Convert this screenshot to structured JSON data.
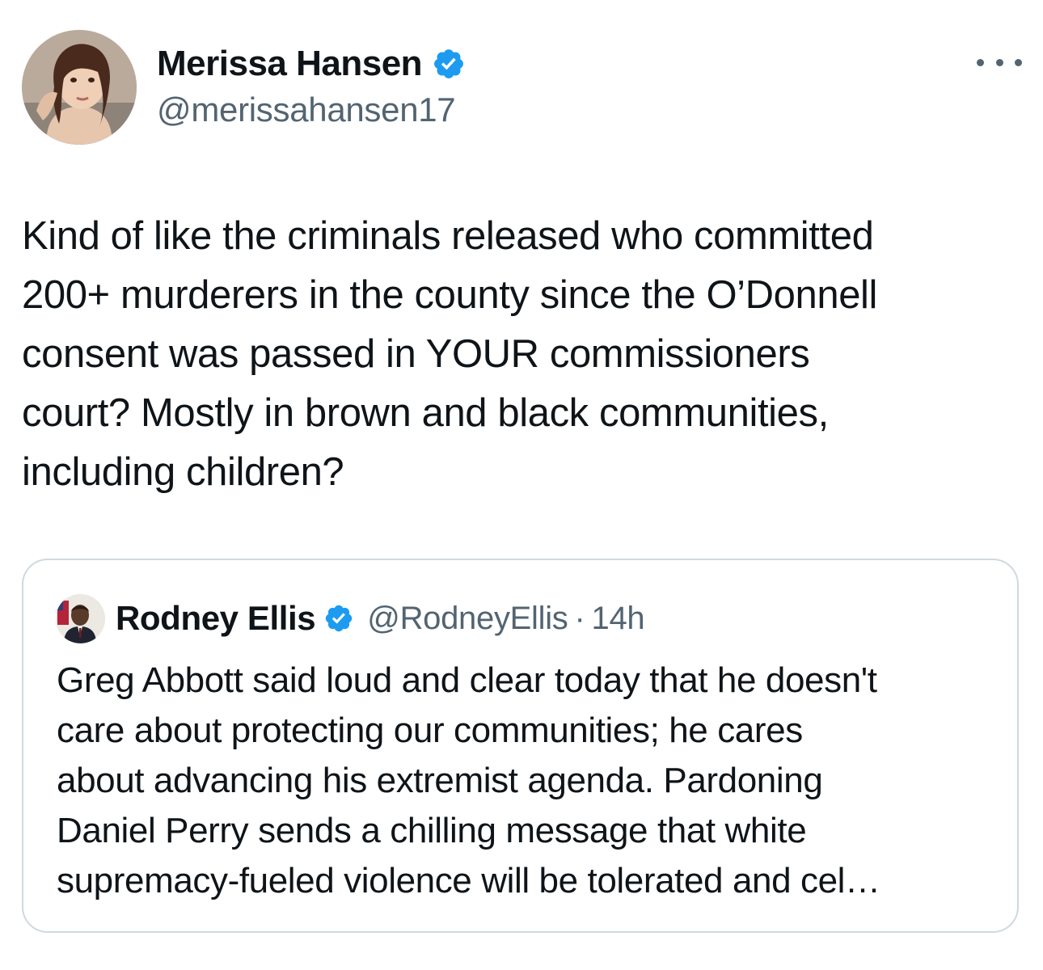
{
  "author": {
    "display_name": "Merissa Hansen",
    "handle": "@merissahansen17",
    "verified": true,
    "avatar": "woman-portrait-avatar"
  },
  "more_icon": "more-options-icon",
  "tweet": {
    "lines": [
      "Kind of like the criminals released who committed",
      "200+  murderers in the county since the O’Donnell",
      "consent was passed in YOUR commissioners",
      "court? Mostly in brown and black communities,",
      "including children?"
    ]
  },
  "quoted_tweet": {
    "display_name": "Rodney Ellis",
    "handle": "@RodneyEllis",
    "separator": "·",
    "time": "14h",
    "verified": true,
    "avatar": "man-suit-portrait-avatar",
    "lines": [
      "Greg Abbott said loud and clear today that he doesn't",
      "care about protecting our communities; he cares",
      "about advancing his extremist agenda. Pardoning",
      "Daniel Perry sends a chilling message that white",
      "supremacy-fueled violence will be tolerated and cel…"
    ]
  },
  "colors": {
    "verified_blue": "#1d9bf0",
    "secondary_text": "#536471",
    "primary_text": "#0f1419",
    "border": "#cfd9de"
  }
}
